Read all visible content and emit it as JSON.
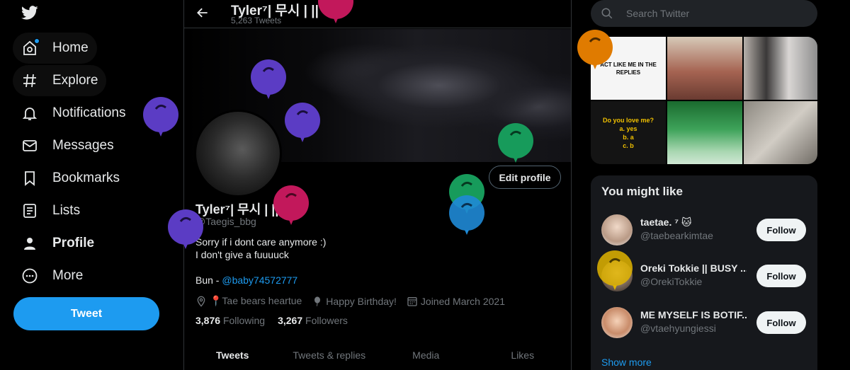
{
  "nav": {
    "items": [
      {
        "label": "Home",
        "icon": "home-icon"
      },
      {
        "label": "Explore",
        "icon": "hashtag-icon"
      },
      {
        "label": "Notifications",
        "icon": "bell-icon"
      },
      {
        "label": "Messages",
        "icon": "envelope-icon"
      },
      {
        "label": "Bookmarks",
        "icon": "bookmark-icon"
      },
      {
        "label": "Lists",
        "icon": "list-icon"
      },
      {
        "label": "Profile",
        "icon": "person-icon"
      },
      {
        "label": "More",
        "icon": "more-circle-icon"
      }
    ],
    "tweet_label": "Tweet"
  },
  "header": {
    "name": "Tyler⁷| 무시 | ||",
    "tweet_count": "5,263 Tweets"
  },
  "profile": {
    "edit_label": "Edit profile",
    "name": "Tyler⁷| 무시 | ||",
    "handle": "@Taegis_bbg",
    "bio_line1": "Sorry if i dont care anymore :)",
    "bio_line2": "I don't give a fuuuuck",
    "bio_link_prefix": "Bun - ",
    "bio_link": "@baby74572777",
    "location": "📍Tae bears heartue",
    "birthday": "Happy Birthday!",
    "joined": "Joined March 2021",
    "following_count": "3,876",
    "following_label": "Following",
    "followers_count": "3,267",
    "followers_label": "Followers"
  },
  "tabs": [
    "Tweets",
    "Tweets & replies",
    "Media",
    "Likes"
  ],
  "search": {
    "placeholder": "Search Twitter"
  },
  "media": {
    "tile1_text": "ACT LIKE ME IN THE REPLIES",
    "tile4_title": "Do you love me?",
    "tile4_a": "a. yes",
    "tile4_b": "b. a",
    "tile4_c": "c. b"
  },
  "suggestions": {
    "title": "You might like",
    "follow_label": "Follow",
    "show_more": "Show more",
    "users": [
      {
        "name": "taetae. ⁷ 🐱",
        "handle": "@taebearkimtae"
      },
      {
        "name": "Oreki Tokkie || BUSY ...",
        "handle": "@OrekiTokkie"
      },
      {
        "name": "ME MYSELF IS BOTIF...",
        "handle": "@vtaehyungiessi"
      }
    ]
  },
  "colors": {
    "accent": "#1d9bf0",
    "balloon_purple": "#5b3cc4",
    "balloon_magenta": "#c2185b",
    "balloon_green": "#179b5b",
    "balloon_blue": "#1f8ad6",
    "balloon_orange": "#e07b00",
    "balloon_yellow": "#e0b400"
  }
}
